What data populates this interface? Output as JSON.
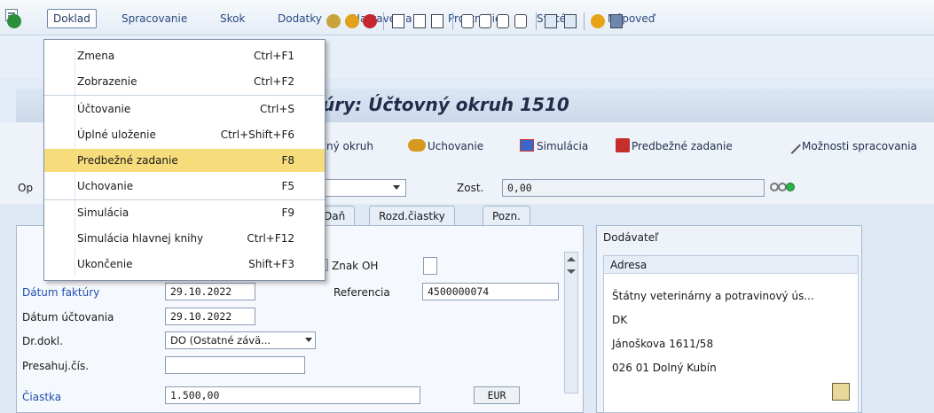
{
  "menubar": {
    "items": [
      "Doklad",
      "Spracovanie",
      "Skok",
      "Dodatky",
      "Nastavenia",
      "Prostredie",
      "Systém",
      "Nápoveď"
    ]
  },
  "window": {
    "title": "Zadanie faktúry: Účtovný okruh 1510",
    "title_visible": "úry: Účtovný okruh 1510"
  },
  "app_toolbar": {
    "okruh": "ný okruh",
    "uchovanie": "Uchovanie",
    "simulacia": "Simulácia",
    "predbezne": "Predbežné zadanie",
    "moznosti": "Možnosti spracovania"
  },
  "header": {
    "op_label": "Op",
    "zost_label": "Zost.",
    "zost_value": "0,00"
  },
  "tabs": [
    "Daň",
    "Rozd.čiastky",
    "Pozn."
  ],
  "form": {
    "znak_oh_label": "Znak OH",
    "datum_faktury_label": "Dátum faktúry",
    "datum_faktury_value": "29.10.2022",
    "referencia_label": "Referencia",
    "referencia_value": "4500000074",
    "datum_uctovania_label": "Dátum účtovania",
    "datum_uctovania_value": "29.10.2022",
    "dr_dokl_label": "Dr.dokl.",
    "dr_dokl_value": "DO (Ostatné závä...",
    "presahuj_label": "Presahuj.čís.",
    "presahuj_value": "",
    "ciastka_label": "Čiastka",
    "ciastka_value": "1.500,00",
    "currency": "EUR"
  },
  "vendor": {
    "group_title": "Dodávateľ",
    "address_header": "Adresa",
    "line1": "Štátny veterinárny a potravinový ús...",
    "line2": "DK",
    "line3": "Jánoškova 1611/58",
    "line4": "026 01 Dolný Kubín"
  },
  "dropdown": {
    "items": [
      {
        "label": "Zmena",
        "shortcut": "Ctrl+F1"
      },
      {
        "label": "Zobrazenie",
        "shortcut": "Ctrl+F2"
      },
      {
        "label": "Účtovanie",
        "shortcut": "Ctrl+S"
      },
      {
        "label": "Úplné uloženie",
        "shortcut": "Ctrl+Shift+F6"
      },
      {
        "label": "Predbežné zadanie",
        "shortcut": "F8"
      },
      {
        "label": "Uchovanie",
        "shortcut": "F5"
      },
      {
        "label": "Simulácia",
        "shortcut": "F9"
      },
      {
        "label": "Simulácia hlavnej knihy",
        "shortcut": "Ctrl+F12"
      },
      {
        "label": "Ukončenie",
        "shortcut": "Shift+F3"
      }
    ]
  },
  "colors": {
    "highlight": "#f7dc7c",
    "link": "#1f4fb0",
    "status_green": "#2db34a"
  }
}
